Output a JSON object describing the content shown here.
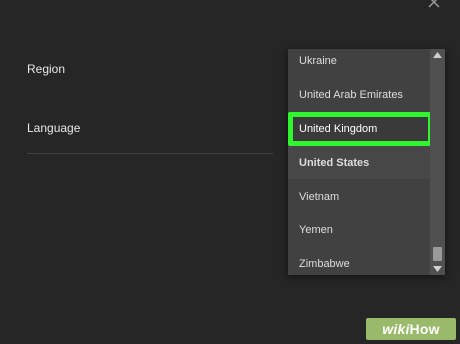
{
  "settings": {
    "region_label": "Region",
    "language_label": "Language"
  },
  "dropdown": {
    "options": [
      {
        "label": "Ukraine",
        "state": "normal"
      },
      {
        "label": "United Arab Emirates",
        "state": "normal"
      },
      {
        "label": "United Kingdom",
        "state": "highlighted"
      },
      {
        "label": "United States",
        "state": "selected"
      },
      {
        "label": "Vietnam",
        "state": "normal"
      },
      {
        "label": "Yemen",
        "state": "normal"
      },
      {
        "label": "Zimbabwe",
        "state": "normal"
      }
    ]
  },
  "watermark": {
    "part1": "wiki",
    "part2": "How"
  },
  "icons": {
    "close": "close-icon",
    "scroll_up": "chevron-up-icon",
    "scroll_down": "chevron-down-icon"
  },
  "colors": {
    "background": "#262626",
    "dropdown_bg": "#414141",
    "highlight_border": "#2ef52e",
    "watermark_bg": "#9aba6b"
  }
}
